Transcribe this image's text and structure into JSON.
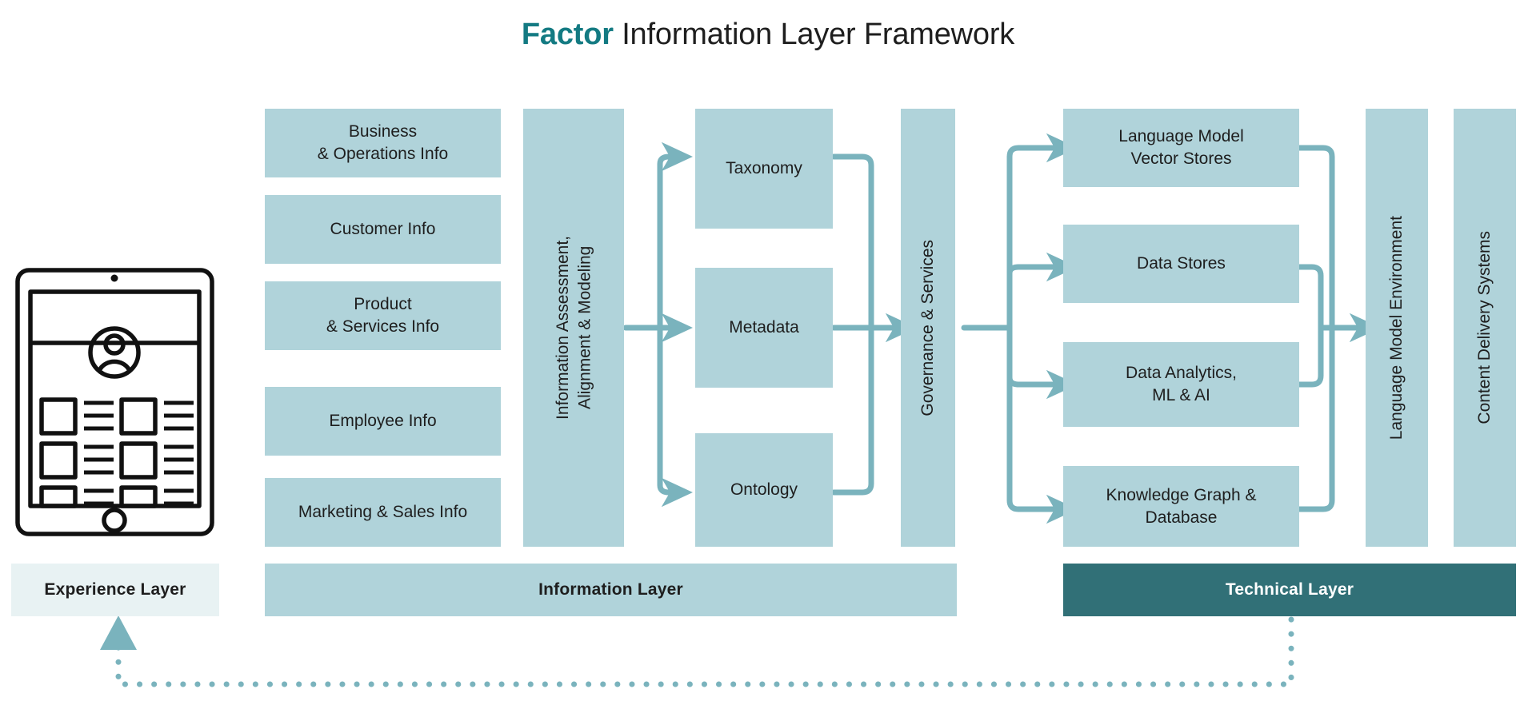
{
  "title": {
    "brand": "Factor",
    "rest": " Information Layer Framework"
  },
  "colors": {
    "box_fill": "#b0d3da",
    "connector": "#7ab3bd",
    "brand_teal": "#137a82",
    "technical_bar": "#317077",
    "experience_bar": "#e8f2f3",
    "text": "#1e1e1e"
  },
  "experience": {
    "device_icon": "tablet-device-icon",
    "layer_label": "Experience Layer"
  },
  "information_inputs": [
    {
      "label": "Business\n& Operations Info"
    },
    {
      "label": "Customer Info"
    },
    {
      "label": "Product\n& Services Info"
    },
    {
      "label": "Employee Info"
    },
    {
      "label": "Marketing & Sales Info"
    }
  ],
  "assessment_column": {
    "label": "Information Assessment,\nAlignment & Modeling"
  },
  "modeling_artifacts": [
    {
      "label": "Taxonomy"
    },
    {
      "label": "Metadata"
    },
    {
      "label": "Ontology"
    }
  ],
  "governance_column": {
    "label": "Governance & Services"
  },
  "technical_components": [
    {
      "label": "Language Model\nVector Stores"
    },
    {
      "label": "Data Stores"
    },
    {
      "label": "Data Analytics,\nML & AI"
    },
    {
      "label": "Knowledge Graph &\nDatabase"
    }
  ],
  "environment_columns": [
    {
      "label": "Language Model Environment"
    },
    {
      "label": "Content Delivery Systems"
    }
  ],
  "layer_bars": {
    "information": "Information Layer",
    "technical": "Technical Layer"
  }
}
